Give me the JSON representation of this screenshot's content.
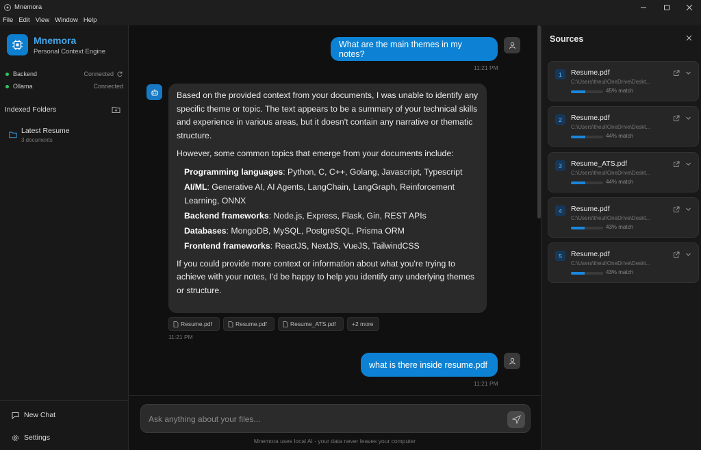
{
  "window": {
    "title": "Mnemora",
    "minimize_icon": "minimize-icon",
    "maximize_icon": "maximize-icon",
    "close_icon": "close-icon"
  },
  "menu": [
    "File",
    "Edit",
    "View",
    "Window",
    "Help"
  ],
  "sidebar": {
    "brand_name": "Mnemora",
    "brand_subtitle": "Personal Context Engine",
    "status": [
      {
        "name": "Backend",
        "value": "Connected"
      },
      {
        "name": "Ollama",
        "value": "Connected"
      }
    ],
    "indexed_title": "Indexed Folders",
    "folders": [
      {
        "name": "Latest Resume",
        "count": "3 documents"
      }
    ],
    "new_chat": "New Chat",
    "settings": "Settings"
  },
  "chat": {
    "messages": [
      {
        "role": "user",
        "text": "What are the main themes in my notes?",
        "time": "11:21 PM"
      },
      {
        "role": "assistant",
        "time": "11:21 PM",
        "p1": "Based on the provided context from your documents, I was unable to identify any specific theme or topic. The text appears to be a summary of your technical skills and experience in various areas, but it doesn't contain any narrative or thematic structure.",
        "p2": "However, some common topics that emerge from your documents include:",
        "items": [
          {
            "label": "Programming languages",
            "text": ": Python, C, C++, Golang, Javascript, Typescript"
          },
          {
            "label": "AI/ML",
            "text": ": Generative AI, AI Agents, LangChain, LangGraph, Reinforcement Learning, ONNX"
          },
          {
            "label": "Backend frameworks",
            "text": ": Node.js, Express, Flask, Gin, REST APIs"
          },
          {
            "label": "Databases",
            "text": ": MongoDB, MySQL, PostgreSQL, Prisma ORM"
          },
          {
            "label": "Frontend frameworks",
            "text": ": ReactJS, NextJS, VueJS, TailwindCSS"
          }
        ],
        "p3": "If you could provide more context or information about what you're trying to achieve with your notes, I'd be happy to help you identify any underlying themes or structure.",
        "chips": [
          "Resume.pdf",
          "Resume.pdf",
          "Resume_ATS.pdf",
          "+2 more"
        ]
      },
      {
        "role": "user",
        "text": "what is there inside resume.pdf",
        "time": "11:21 PM"
      }
    ],
    "input_placeholder": "Ask anything about your files...",
    "footnote": "Mnemora uses local AI - your data never leaves your computer"
  },
  "sources": {
    "title": "Sources",
    "items": [
      {
        "num": "1",
        "name": "Resume.pdf",
        "path": "C:\\Users\\theul\\OneDrive\\Deskt...",
        "match": "45% match",
        "score": 0.45
      },
      {
        "num": "2",
        "name": "Resume.pdf",
        "path": "C:\\Users\\theul\\OneDrive\\Deskt...",
        "match": "44% match",
        "score": 0.44
      },
      {
        "num": "3",
        "name": "Resume_ATS.pdf",
        "path": "C:\\Users\\theul\\OneDrive\\Deskt...",
        "match": "44% match",
        "score": 0.44
      },
      {
        "num": "4",
        "name": "Resume.pdf",
        "path": "C:\\Users\\theul\\OneDrive\\Deskt...",
        "match": "43% match",
        "score": 0.43
      },
      {
        "num": "5",
        "name": "Resume.pdf",
        "path": "C:\\Users\\theul\\OneDrive\\Deskt...",
        "match": "43% match",
        "score": 0.43
      }
    ]
  }
}
